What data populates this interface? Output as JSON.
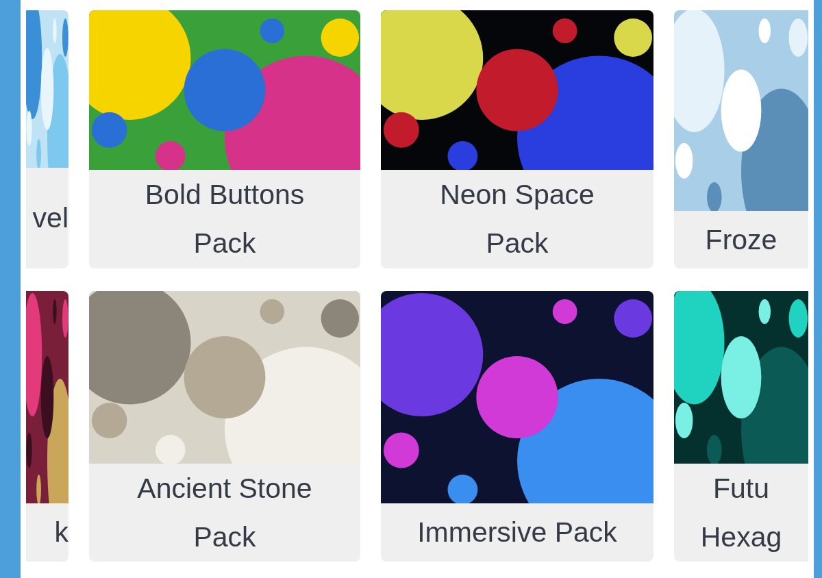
{
  "cards": [
    {
      "image": {
        "kind": "picture"
      },
      "title_lines": [
        "vel"
      ]
    },
    {
      "image": {
        "kind": "picture"
      },
      "title_lines": [
        "Bold Buttons",
        "Pack"
      ]
    },
    {
      "image": {
        "kind": "picture"
      },
      "title_lines": [
        "Neon Space",
        "Pack"
      ]
    },
    {
      "image": {
        "kind": "picture"
      },
      "title_lines": [
        "Froze"
      ]
    },
    {
      "image": {
        "kind": "picture"
      },
      "title_lines": [
        "k"
      ]
    },
    {
      "image": {
        "kind": "picture"
      },
      "title_lines": [
        "Ancient Stone",
        "Pack"
      ]
    },
    {
      "image": {
        "kind": "picture"
      },
      "title_lines": [
        "Immersive Pack"
      ]
    },
    {
      "image": {
        "kind": "picture"
      },
      "title_lines": [
        "Futu",
        "Hexag"
      ]
    }
  ]
}
